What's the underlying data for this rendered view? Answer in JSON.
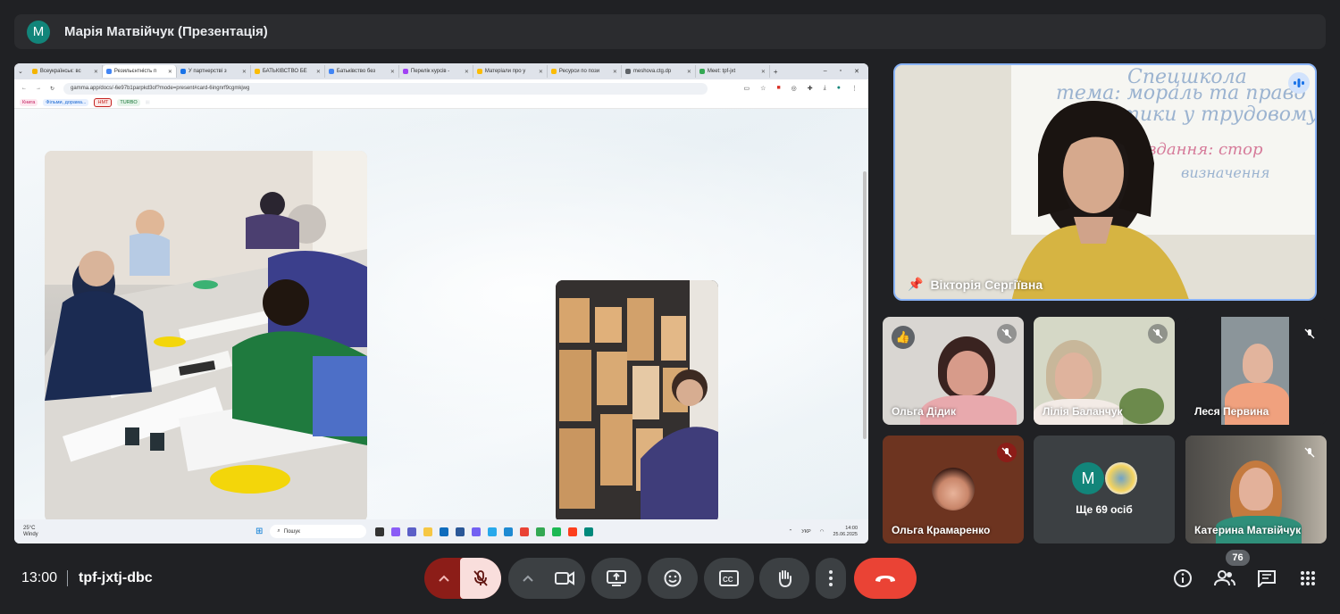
{
  "presenter": {
    "avatar_letter": "M",
    "title": "Марія Матвійчук (Презентація)"
  },
  "browser": {
    "tabs": [
      {
        "label": "Всеукраїнськ: вс",
        "color": "#f4b400"
      },
      {
        "label": "Резильєнтність п",
        "color": "#4285f4"
      },
      {
        "label": "У партнерстві з",
        "color": "#1a73e8"
      },
      {
        "label": "БАТЬКІВСТВО БЕ",
        "color": "#fbbc04"
      },
      {
        "label": "Батьківство без",
        "color": "#4285f4"
      },
      {
        "label": "Перелік курсів -",
        "color": "#a142f4"
      },
      {
        "label": "Матеріали про у",
        "color": "#fbbc04"
      },
      {
        "label": "Ресурси по пози",
        "color": "#fbbc04"
      },
      {
        "label": "meshova.ctg.dp",
        "color": "#5f6368"
      },
      {
        "label": "Meet: tpf-jxt",
        "color": "#34a853"
      }
    ],
    "url": "gamma.app/docs/-6e97b1parpkd3of?mode=present#card-6ingnrf9cgmkjwg",
    "bookmarks": [
      {
        "label": "Книга",
        "bg": "#fde7ef",
        "fg": "#c2185b"
      },
      {
        "label": "Фільми, дорама...",
        "bg": "#e8f0fe",
        "fg": "#1967d2"
      },
      {
        "label": "НМТ",
        "bg": "#fce8e6",
        "fg": "#c5221f"
      },
      {
        "label": "TURBO",
        "bg": "#e6f4ea",
        "fg": "#137333"
      }
    ]
  },
  "taskbar": {
    "weather_temp": "25°C",
    "weather_desc": "Windy",
    "search_placeholder": "Пошук",
    "lang": "УКР",
    "time": "14:00",
    "date": "25.06.2025"
  },
  "main_tile": {
    "name": "Вікторія Сергіївна"
  },
  "participants": [
    {
      "name": "Ольга Дідик",
      "reaction": "👍"
    },
    {
      "name": "Лілія Баланчук"
    },
    {
      "name": "Леся Первина"
    },
    {
      "name": "Ольга Крамаренко"
    },
    {
      "name": "Ще 69 осіб",
      "avatar_letter": "M"
    },
    {
      "name": "Катерина Матвійчук"
    }
  ],
  "controls": {
    "time": "13:00",
    "meeting_code": "tpf-jxtj-dbc",
    "people_count": "76"
  },
  "colors": {
    "accent_blue": "#8ab4f8",
    "end_call": "#ea4335",
    "mic_off_bg": "#f9dedc",
    "mic_off_tray": "#8c1d18"
  }
}
